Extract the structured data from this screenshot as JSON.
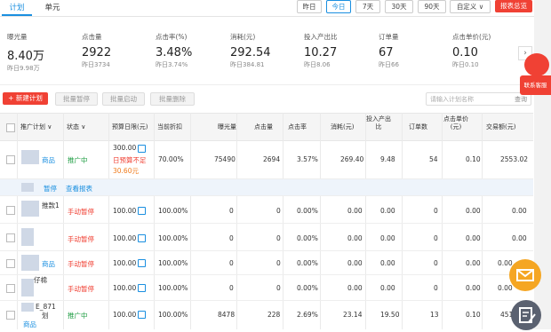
{
  "tabs": [
    {
      "label": "计划"
    },
    {
      "label": "单元"
    }
  ],
  "date_buttons": [
    {
      "label": "昨日"
    },
    {
      "label": "今日"
    },
    {
      "label": "7天"
    },
    {
      "label": "30天"
    },
    {
      "label": "90天"
    },
    {
      "label": "自定义 ∨"
    }
  ],
  "report_button": "报表总览",
  "metrics": [
    {
      "label": "曝光量",
      "value": "8.40万",
      "prev": "昨日9.98万"
    },
    {
      "label": "点击量",
      "value": "2922",
      "prev": "昨日3734"
    },
    {
      "label": "点击率(%)",
      "value": "3.48%",
      "prev": "昨日3.74%"
    },
    {
      "label": "消耗(元)",
      "value": "292.54",
      "prev": "昨日384.81"
    },
    {
      "label": "投入产出比",
      "value": "10.27",
      "prev": "昨日8.06"
    },
    {
      "label": "订单量",
      "value": "67",
      "prev": "昨日66"
    },
    {
      "label": "点击单价(元)",
      "value": "0.10",
      "prev": "昨日0.10"
    }
  ],
  "toolbar": {
    "new_plan": "+ 新建计划",
    "bulk_pause": "批量暂停",
    "bulk_start": "批量启动",
    "bulk_delete": "批量删除",
    "search_placeholder": "请输入计划名称",
    "search_btn": "查询"
  },
  "columns": {
    "plan": "推广计划 ∨",
    "status": "状态 ∨",
    "budget": "预算日限(元)",
    "discount": "当前折扣",
    "impr": "曝光量",
    "clicks": "点击量",
    "ctr": "点击率",
    "cost": "消耗(元)",
    "roi": "投入产出比",
    "orders": "订单数",
    "cpc": "点击单价(元)",
    "gmv": "交易额(元)"
  },
  "rows": {
    "r1": {
      "tag": "商品",
      "status": "推广中",
      "budget": "300.00",
      "budget_note": "日预算不足",
      "budget_extra": "30.60元",
      "discount": "70.00%",
      "impr": "75490",
      "clicks": "2694",
      "ctr": "3.57%",
      "cost": "269.40",
      "roi": "9.48",
      "orders": "54",
      "cpc": "0.10",
      "gmv": "2553.02"
    },
    "bar": {
      "pause": "暂停",
      "report": "查看报表"
    },
    "r2": {
      "name": "推款1",
      "status": "手动暂停",
      "budget": "100.00",
      "discount": "100.00%",
      "impr": "0",
      "clicks": "0",
      "ctr": "0.00%",
      "cost": "0.00",
      "roi": "0.00",
      "orders": "0",
      "cpc": "0.00",
      "gmv": "0.00"
    },
    "r3": {
      "status": "手动暂停",
      "budget": "100.00",
      "discount": "100.00%",
      "impr": "0",
      "clicks": "0",
      "ctr": "0.00%",
      "cost": "0.00",
      "roi": "0.00",
      "orders": "0",
      "cpc": "0.00",
      "gmv": "0.00"
    },
    "r4": {
      "tag": "商品",
      "status": "手动暂停",
      "budget": "100.00",
      "discount": "100.00%",
      "impr": "0",
      "clicks": "0",
      "ctr": "0.00%",
      "cost": "0.00",
      "roi": "0.00",
      "orders": "0",
      "cpc": "0.00",
      "gmv": "0.00"
    },
    "r5": {
      "name": "仔棉",
      "status": "手动暂停",
      "budget": "100.00",
      "discount": "100.00%",
      "impr": "0",
      "clicks": "0",
      "ctr": "0.00%",
      "cost": "0.00",
      "roi": "0.00",
      "orders": "0",
      "cpc": "0.00",
      "gmv": "0.00"
    },
    "r6": {
      "name": "E_871",
      "name2": "划",
      "tag": "商品",
      "status": "推广中",
      "budget": "100.00",
      "discount": "100.00%",
      "impr": "8478",
      "clicks": "228",
      "ctr": "2.69%",
      "cost": "23.14",
      "roi": "19.50",
      "orders": "13",
      "cpc": "0.10",
      "gmv": "451.12"
    }
  },
  "side": {
    "contact": "联系客服"
  }
}
